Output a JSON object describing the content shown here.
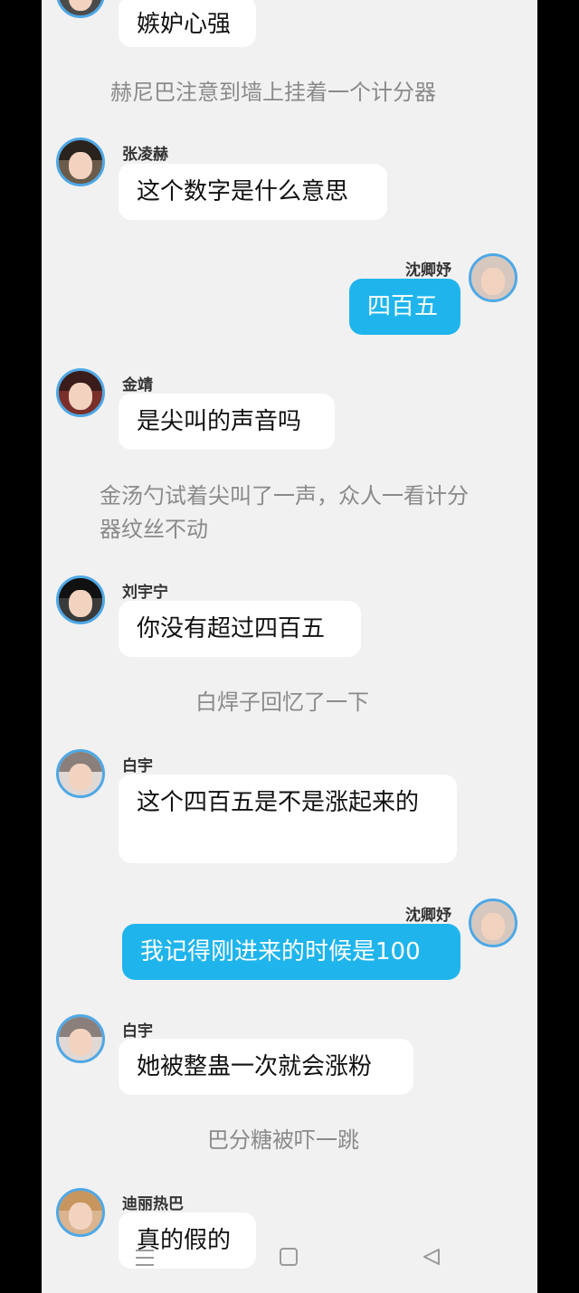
{
  "messages": [
    {
      "type": "left",
      "text": "嫉妒心强"
    },
    {
      "type": "narration",
      "text": "赫尼巴注意到墙上挂着一个计分器"
    },
    {
      "type": "left",
      "name": "张凌赫",
      "text": "这个数字是什么意思"
    },
    {
      "type": "right",
      "name": "沈卿妤",
      "text": "四百五"
    },
    {
      "type": "left",
      "name": "金靖",
      "text": "是尖叫的声音吗"
    },
    {
      "type": "narration",
      "text": "金汤勺试着尖叫了一声，众人一看计分器纹丝不动"
    },
    {
      "type": "left",
      "name": "刘宇宁",
      "text": "你没有超过四百五"
    },
    {
      "type": "narration",
      "text": "白焊子回忆了一下"
    },
    {
      "type": "left",
      "name": "白宇",
      "text": "这个四百五是不是涨起来的"
    },
    {
      "type": "right",
      "name": "沈卿妤",
      "text": "我记得刚进来的时候是100"
    },
    {
      "type": "left",
      "name": "白宇",
      "text": "她被整蛊一次就会涨粉"
    },
    {
      "type": "narration",
      "text": "巴分糖被吓一跳"
    },
    {
      "type": "left",
      "name": "迪丽热巴",
      "text": "真的假的"
    }
  ],
  "navbar": {
    "menu": "menu-icon",
    "home": "home-icon",
    "back": "back-icon"
  }
}
